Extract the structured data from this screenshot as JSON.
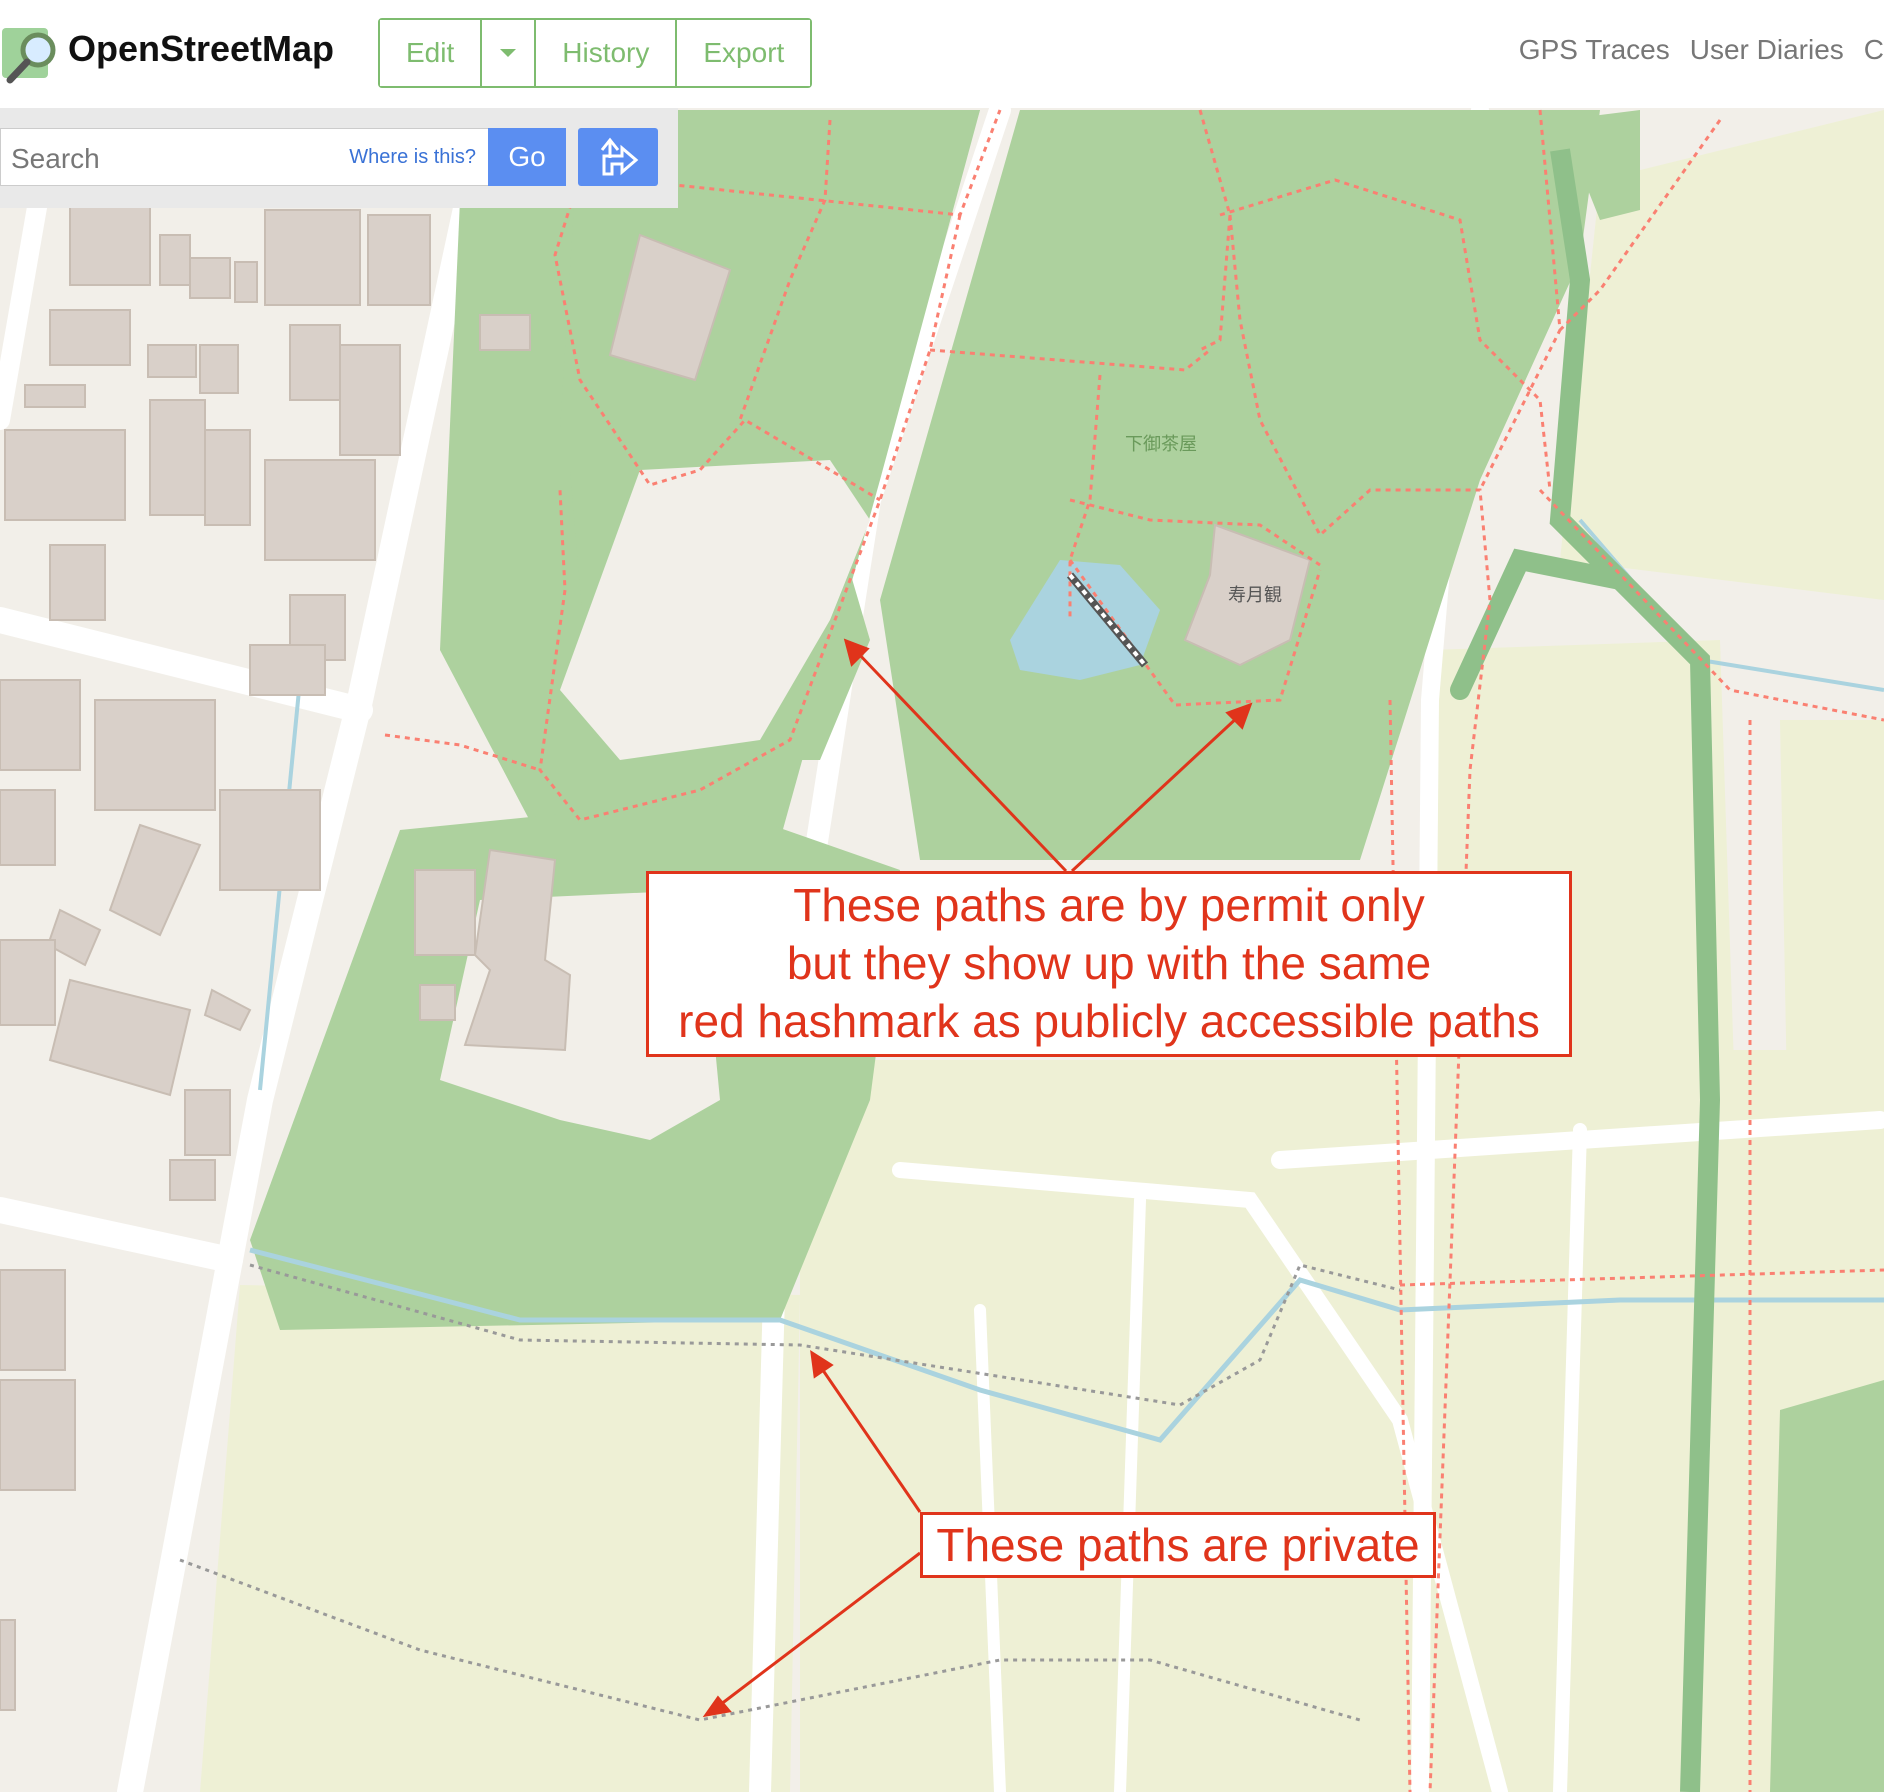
{
  "header": {
    "brand": "OpenStreetMap",
    "edit_label": "Edit",
    "history_label": "History",
    "export_label": "Export",
    "nav": [
      "GPS Traces",
      "User Diaries",
      "C"
    ]
  },
  "search": {
    "placeholder": "Search",
    "where_label": "Where is this?",
    "go_label": "Go"
  },
  "map": {
    "labels": [
      "下御茶屋",
      "寿月観"
    ],
    "colors": {
      "background": "#f2efe9",
      "park": "#add19e",
      "building": "#d9d0c9",
      "residential": "#eef0d5",
      "water": "#aad3df",
      "path": "#fa8072",
      "road": "#ffffff"
    }
  },
  "annotations": {
    "permit_text": [
      "These paths are by permit only",
      "but they show up with the same",
      "red hashmark as publicly accessible paths"
    ],
    "private_text": "These paths are private"
  }
}
